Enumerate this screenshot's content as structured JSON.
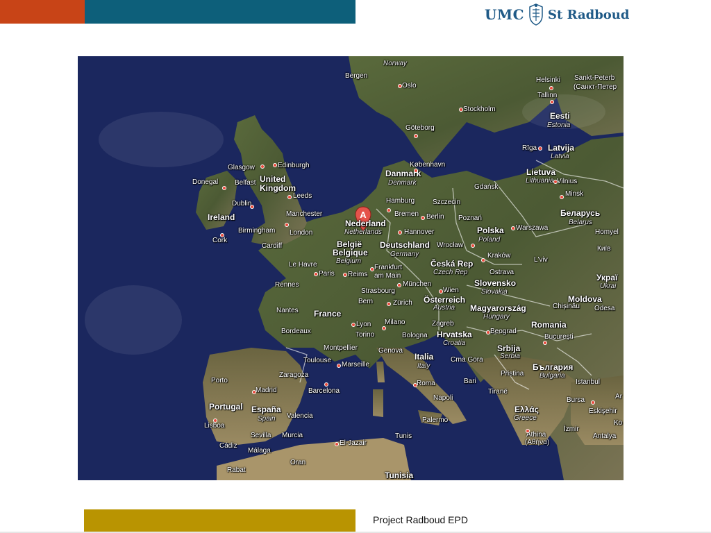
{
  "colors": {
    "red": "#c84417",
    "teal": "#0d5f7a",
    "gold": "#b99401",
    "logo": "#1f5a87",
    "marker": "#e5534b",
    "sea": "#1e2a63"
  },
  "header": {
    "logo": {
      "umc": "UMC",
      "name": "St Radboud",
      "icon": "shield-crest-icon"
    }
  },
  "footer": {
    "text": "Project Radboud EPD"
  },
  "map": {
    "marker_letter": "A",
    "countries": {
      "united_kingdom_1": "United",
      "united_kingdom_2": "Kingdom",
      "ireland": "Ireland",
      "danmark": "Danmark",
      "danmark_native": "Denmark",
      "nederland": "Nederland",
      "netherlands": "Netherlands",
      "belgie": "België",
      "belgique": "Belgique",
      "belgium": "Belgium",
      "deutschland": "Deutschland",
      "germany": "Germany",
      "france": "France",
      "polska": "Polska",
      "poland": "Poland",
      "ceska_rep": "Česká Rep",
      "czech_rep": "Czech Rep",
      "slovensko": "Slovensko",
      "slovakia": "Slovakia",
      "osterreich": "Österreich",
      "austria": "Austria",
      "magyarorszag": "Magyarország",
      "hungary": "Hungary",
      "hrvatska": "Hrvatska",
      "croatia": "Croatia",
      "srbija": "Srbija",
      "serbia": "Serbia",
      "italia": "Italia",
      "italy": "Italy",
      "romania": "Romania",
      "bulgaria_native": "България",
      "bulgaria": "Bulgaria",
      "ellas": "Ελλάς",
      "greece": "Greece",
      "espana": "España",
      "spain": "Spain",
      "portugal": "Portugal",
      "latvija": "Latvija",
      "latvia": "Latvia",
      "lietuva": "Lietuva",
      "lithuania": "Lithuania",
      "eesti": "Eesti",
      "estonia": "Estonia",
      "belarus_native": "Беларусь",
      "belarus": "Belarus",
      "moldova": "Moldova",
      "ukraine_native": "Украї",
      "ukraine": "Ukrai",
      "norway": "Norway",
      "tunisia": "Tunisia"
    },
    "cities": {
      "bergen": "Bergen",
      "oslo": "Oslo",
      "stockholm": "Stockholm",
      "goteborg": "Göteborg",
      "helsinki": "Helsinki",
      "sankt_peterburg": "Sankt-Peterb",
      "sankt_peterburg_cyr": "(Санкт-Петер",
      "tallinn": "Tallinn",
      "riga": "Rīga",
      "vilnius": "Vilnius",
      "minsk": "Minsk",
      "kobenhavn": "København",
      "gdansk": "Gdańsk",
      "glasgow": "Glasgow",
      "edinburgh": "Edinburgh",
      "donegal": "Donegal",
      "belfast": "Belfast",
      "leeds": "Leeds",
      "dublin": "Dublin",
      "manchester": "Manchester",
      "birmingham": "Birmingham",
      "london": "London",
      "cork": "Cork",
      "cardiff": "Cardiff",
      "hamburg": "Hamburg",
      "bremen": "Bremen",
      "szczecin": "Szczecin",
      "berlin": "Berlin",
      "hannover": "Hannover",
      "poznan": "Poznań",
      "warszawa": "Warszawa",
      "homyel": "Homyel",
      "kyiv": "Київ",
      "wroclaw": "Wrocław",
      "krakow": "Kraków",
      "lviv": "L'viv",
      "ostrava": "Ostrava",
      "le_havre": "Le Havre",
      "paris": "Paris",
      "reims": "Reims",
      "frankfurt_1": "Frankfurt",
      "frankfurt_2": "am Main",
      "rennes": "Rennes",
      "strasbourg": "Strasbourg",
      "munchen": "München",
      "wien": "Wien",
      "bern": "Bern",
      "zurich": "Zürich",
      "nantes": "Nantes",
      "chisinau": "Chișinău",
      "odesa": "Odesa",
      "lyon": "Lyon",
      "milano": "Milano",
      "zagreb": "Zagreb",
      "beograd": "Beograd",
      "bordeaux": "Bordeaux",
      "torino": "Torino",
      "bologna": "Bologna",
      "bucuresti": "București",
      "montpellier": "Montpellier",
      "genova": "Genova",
      "toulouse": "Toulouse",
      "marseille": "Marseille",
      "crna_gora": "Crna Gora",
      "zaragoza": "Zaragoza",
      "pristina": "Pristina",
      "porto": "Porto",
      "madrid": "Madrid",
      "barcelona": "Barcelona",
      "roma": "Roma",
      "bari": "Bari",
      "istanbul": "Istanbul",
      "tirane": "Tiranë",
      "napoli": "Napoli",
      "bursa": "Bursa",
      "eskisehir": "Eskişehir",
      "lisboa": "Lisboa",
      "valencia": "Valencia",
      "sevilla": "Sevilla",
      "murcia": "Murcia",
      "palermo": "Palermo",
      "izmir": "İzmir",
      "antalya": "Antalya",
      "athina": "Athina",
      "athina_greek": "(Αθήνα)",
      "cadiz": "Cádiz",
      "malaga": "Málaga",
      "el_jazair": "El-Jazair",
      "tunis": "Tunis",
      "oran": "Oran",
      "rabat": "Rabat",
      "ar": "Ar",
      "ko": "Ko"
    }
  }
}
